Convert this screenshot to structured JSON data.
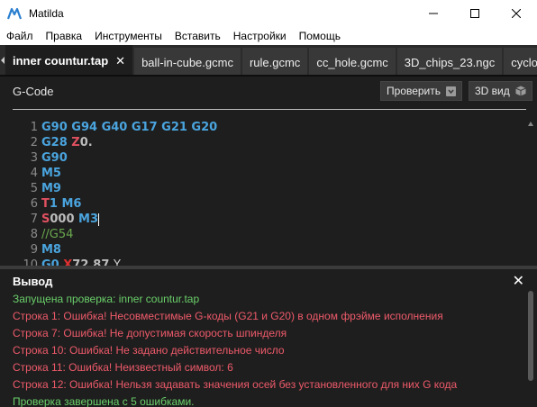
{
  "window": {
    "title": "Matilda"
  },
  "menu": [
    "Файл",
    "Правка",
    "Инструменты",
    "Вставить",
    "Настройки",
    "Помощь"
  ],
  "tabs": [
    {
      "label": "inner countur.tap",
      "active": true,
      "close": "✕"
    },
    {
      "label": "ball-in-cube.gcmc"
    },
    {
      "label": "rule.gcmc"
    },
    {
      "label": "cc_hole.gcmc"
    },
    {
      "label": "3D_chips_23.ngc"
    },
    {
      "label": "cycloids"
    }
  ],
  "gcode": {
    "label": "G-Code",
    "check_button": "Проверить",
    "view3d_button": "3D вид"
  },
  "lines": [
    {
      "n": "1",
      "tokens": [
        {
          "t": "g",
          "v": "G90 G94 G40 G17 G21 G20"
        }
      ]
    },
    {
      "n": "2",
      "tokens": [
        {
          "t": "g",
          "v": "G28 "
        },
        {
          "t": "t",
          "v": "Z"
        },
        {
          "t": "v",
          "v": "0."
        }
      ]
    },
    {
      "n": "3",
      "tokens": [
        {
          "t": "g",
          "v": "G90"
        }
      ]
    },
    {
      "n": "4",
      "tokens": [
        {
          "t": "m",
          "v": "M5"
        }
      ]
    },
    {
      "n": "5",
      "tokens": [
        {
          "t": "m",
          "v": "M9"
        }
      ]
    },
    {
      "n": "6",
      "tokens": [
        {
          "t": "t",
          "v": "T"
        },
        {
          "t": "n",
          "v": "1 "
        },
        {
          "t": "m",
          "v": "M6"
        }
      ]
    },
    {
      "n": "7",
      "tokens": [
        {
          "t": "s",
          "v": "S"
        },
        {
          "t": "v",
          "v": "000 "
        },
        {
          "t": "m",
          "v": "M3"
        }
      ]
    },
    {
      "n": "8",
      "tokens": [
        {
          "t": "c",
          "v": "//G54"
        }
      ]
    },
    {
      "n": "9",
      "tokens": [
        {
          "t": "m",
          "v": "M8"
        }
      ]
    },
    {
      "n": "10",
      "tokens": [
        {
          "t": "g",
          "v": "G0 "
        },
        {
          "t": "x",
          "v": "X"
        },
        {
          "t": "v",
          "v": "72.87 "
        },
        {
          "t": "w",
          "v": "Y"
        }
      ]
    }
  ],
  "output": {
    "title": "Вывод",
    "close": "✕",
    "lines": [
      {
        "kind": "ok",
        "text": "Запущена проверка: inner countur.tap"
      },
      {
        "kind": "err",
        "text": "Строка 1:  Ошибка! Несовместимые G-коды (G21 и G20) в одном фрэйме исполнения"
      },
      {
        "kind": "err",
        "text": "Строка 7:  Ошибка! Не допустимая скорость шпинделя"
      },
      {
        "kind": "err",
        "text": "Строка 10:  Ошибка! Не задано действительное число"
      },
      {
        "kind": "err",
        "text": "Строка 11:  Ошибка! Неизвестный символ: 6"
      },
      {
        "kind": "err",
        "text": "Строка 12:  Ошибка! Нельзя задавать значения осей без установленного для них G кода"
      },
      {
        "kind": "ok",
        "text": "Проверка завершена с 5 ошибками."
      }
    ]
  },
  "colors": {
    "ok": "#6ad06a",
    "error": "#ee5a6a",
    "gcode": "#4aa4de",
    "letter": "#e05060"
  }
}
